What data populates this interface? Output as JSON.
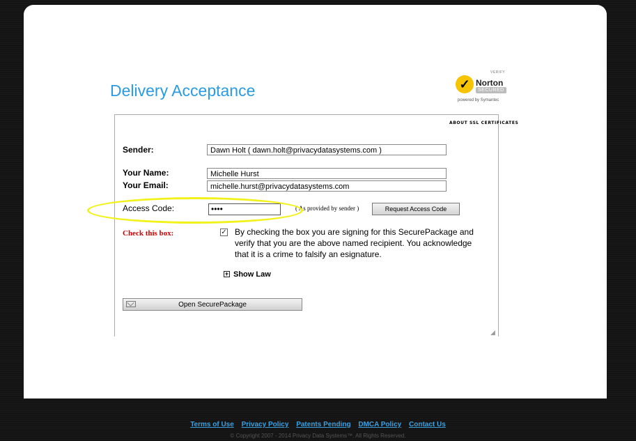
{
  "page": {
    "title": "Delivery Acceptance"
  },
  "norton": {
    "verify": "VERIFY",
    "brand": "Norton",
    "secured": "SECURED",
    "powered_by": "powered by Symantec",
    "brand_color": "#f6c400"
  },
  "ssl_link": "ABOUT SSL CERTIFICATES",
  "form": {
    "sender_label": "Sender:",
    "sender_value": "Dawn Holt ( dawn.holt@privacydatasystems.com )",
    "your_name_label": "Your Name:",
    "your_name_value": "Michelle Hurst",
    "your_email_label": "Your Email:",
    "your_email_value": "michelle.hurst@privacydatasystems.com",
    "access_code_label": "Access Code:",
    "access_code_value": "••••",
    "access_code_note": "( As provided by sender )",
    "request_button": "Request Access Code",
    "check_label": "Check this box:",
    "check_mark": "✓",
    "agreement_text": "By checking the box you are signing for this SecurePackage and verify that you are the above named recipient. You acknowledge that it is a crime to falsify an esignature.",
    "show_law_icon": "+",
    "show_law": "Show Law",
    "open_button": "Open SecurePackage"
  },
  "colors": {
    "title": "#2a9be0",
    "check_label": "#cc0000",
    "link": "#3aa0e0",
    "highlight": "#f2f21a"
  },
  "footer": {
    "links": [
      "Terms of Use",
      "Privacy Policy",
      "Patents Pending",
      "DMCA Policy",
      "Contact Us"
    ],
    "copyright": "© Copyright 2007 - 2014 Privacy Data Systems™. All Rights Reserved."
  }
}
